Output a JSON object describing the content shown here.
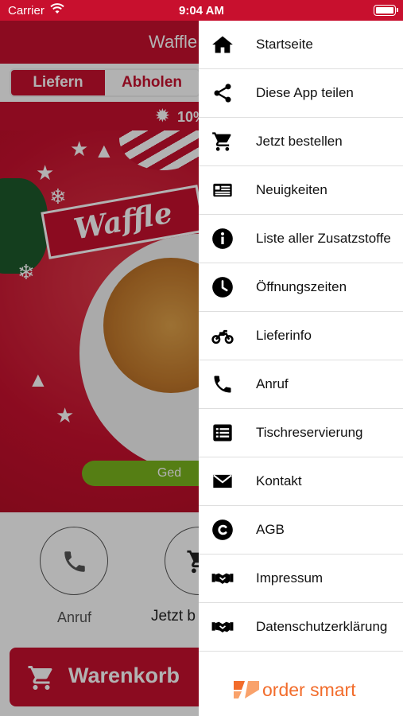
{
  "status_bar": {
    "carrier": "Carrier",
    "time": "9:04 AM"
  },
  "app": {
    "title": "Waffle",
    "tabs": [
      {
        "label": "Liefern",
        "active": true
      },
      {
        "label": "Abholen",
        "active": false
      }
    ],
    "promo_text": "10%",
    "hero_logo_text": "Waffle",
    "hero_button_label": "Ged",
    "actions": [
      {
        "label": "Anruf",
        "icon": "phone-icon"
      },
      {
        "label": "Jetzt b",
        "icon": "cart-icon"
      }
    ],
    "cart_button_label": "Warenkorb"
  },
  "drawer": {
    "items": [
      {
        "label": "Startseite",
        "icon": "home-icon"
      },
      {
        "label": "Diese App teilen",
        "icon": "share-icon"
      },
      {
        "label": "Jetzt bestellen",
        "icon": "cart-icon"
      },
      {
        "label": "Neuigkeiten",
        "icon": "newspaper-icon"
      },
      {
        "label": "Liste aller Zusatzstoffe",
        "icon": "info-icon"
      },
      {
        "label": "Öffnungszeiten",
        "icon": "clock-icon"
      },
      {
        "label": "Lieferinfo",
        "icon": "motorcycle-icon"
      },
      {
        "label": "Anruf",
        "icon": "phone-icon"
      },
      {
        "label": "Tischreservierung",
        "icon": "list-icon"
      },
      {
        "label": "Kontakt",
        "icon": "envelope-icon"
      },
      {
        "label": "AGB",
        "icon": "copyright-icon"
      },
      {
        "label": "Impressum",
        "icon": "handshake-icon"
      },
      {
        "label": "Datenschutzerklärung",
        "icon": "handshake-icon"
      }
    ],
    "brand": "order smart"
  },
  "colors": {
    "brand_red": "#c8102e",
    "accent_green": "#7ab51d",
    "brand_orange": "#f26c2b"
  }
}
